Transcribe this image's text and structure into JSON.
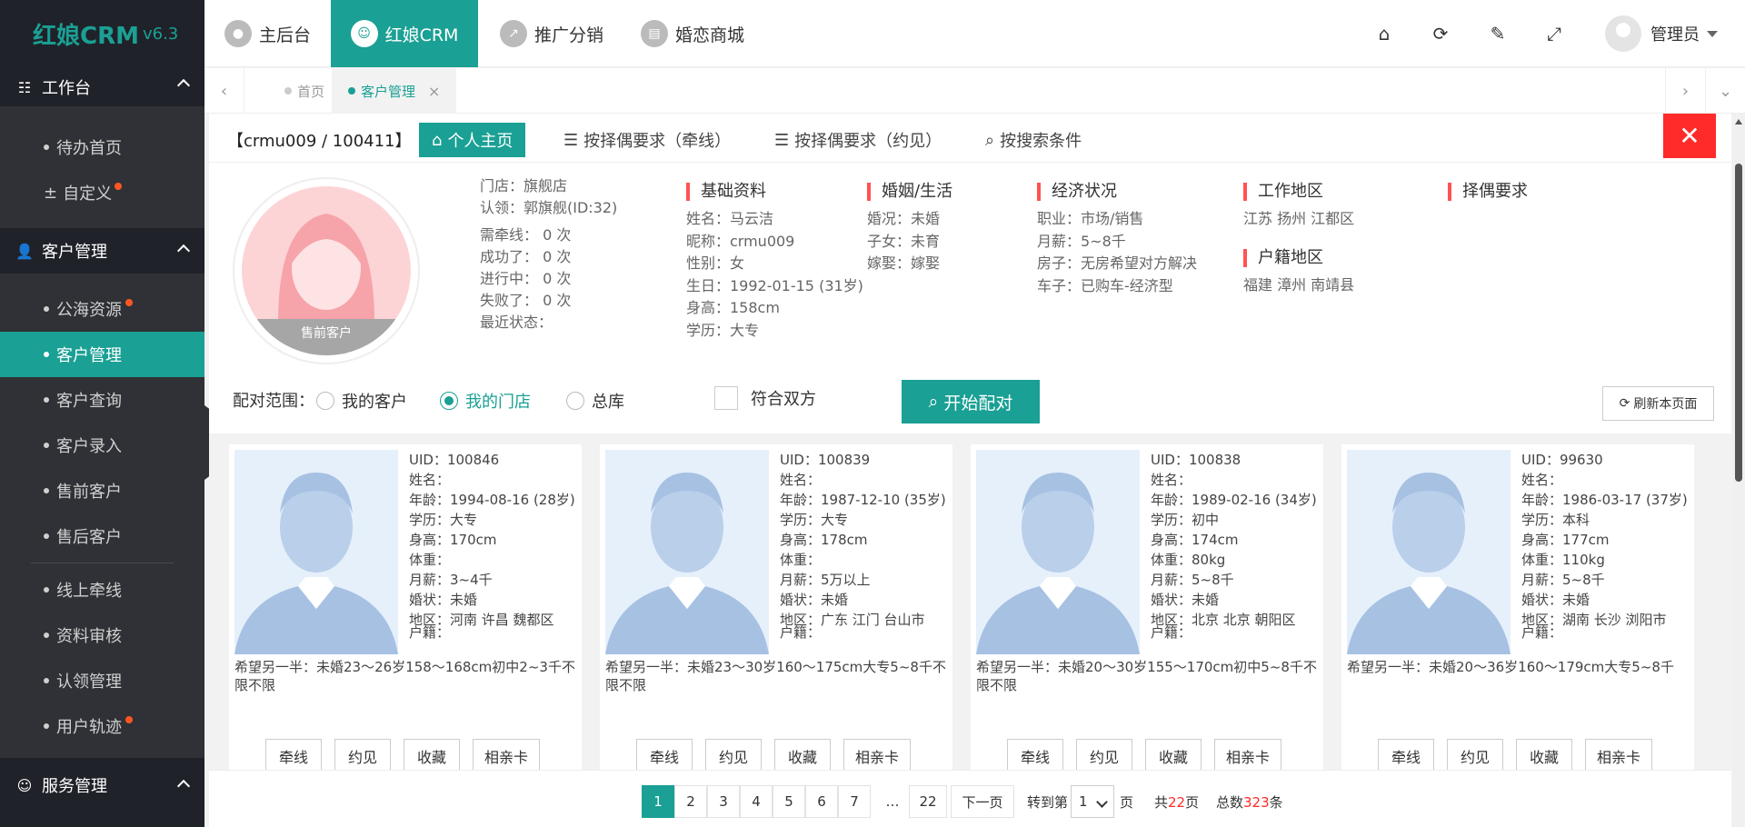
{
  "logo": {
    "name": "红娘CRM",
    "version": "v6.3"
  },
  "sidebar": {
    "groups": [
      {
        "title": "工作台",
        "items": [
          {
            "label": "待办首页"
          },
          {
            "label": "自定义"
          }
        ]
      },
      {
        "title": "客户管理",
        "items": [
          {
            "label": "公海资源"
          },
          {
            "label": "客户管理"
          },
          {
            "label": "客户查询"
          },
          {
            "label": "客户录入"
          },
          {
            "label": "售前客户"
          },
          {
            "label": "售后客户"
          },
          {
            "label": "线上牵线"
          },
          {
            "label": "资料审核"
          },
          {
            "label": "认领管理"
          },
          {
            "label": "用户轨迹"
          }
        ]
      },
      {
        "title": "服务管理",
        "items": []
      }
    ]
  },
  "header": {
    "tabs": [
      {
        "label": "主后台"
      },
      {
        "label": "红娘CRM"
      },
      {
        "label": "推广分销"
      },
      {
        "label": "婚恋商城"
      }
    ],
    "user": "管理员"
  },
  "pagetabs": [
    {
      "label": "首页"
    },
    {
      "label": "客户管理"
    }
  ],
  "toolbar": {
    "customer_id": "【crmu009 / 100411】",
    "buttons": [
      "个人主页",
      "按择偶要求（牵线）",
      "按择偶要求（约见）",
      "按搜索条件"
    ]
  },
  "profile": {
    "photo_label": "售前客户",
    "store": "门店：旗舰店",
    "claim": "认领：郭旗舰(ID:32)",
    "stats": [
      "需牵线：  0 次",
      "成功了：  0 次",
      "进行中：  0 次",
      "失败了：  0 次",
      "最近状态："
    ],
    "sections": {
      "basic": {
        "title": "基础资料",
        "lines": [
          "姓名：马云洁",
          "昵称：crmu009",
          "性别：女",
          "生日：1992-01-15 (31岁)",
          "身高：158cm",
          "学历：大专"
        ]
      },
      "marriage": {
        "title": "婚姻/生活",
        "lines": [
          "婚况：未婚",
          "子女：未育",
          "嫁娶：嫁娶"
        ]
      },
      "economy": {
        "title": "经济状况",
        "lines": [
          "职业：市场/销售",
          "月薪：5~8千",
          "房子：无房希望对方解决",
          "车子：已购车-经济型"
        ]
      },
      "work": {
        "title": "工作地区",
        "lines": [
          "江苏 扬州 江都区"
        ]
      },
      "hukou": {
        "title": "户籍地区",
        "lines": [
          "福建 漳州 南靖县"
        ]
      },
      "mate": {
        "title": "择偶要求",
        "lines": []
      }
    }
  },
  "match": {
    "label": "配对范围：",
    "options": [
      "我的客户",
      "我的门店",
      "总库"
    ],
    "selected": "我的门店",
    "both_label": "符合双方",
    "start_label": "开始配对",
    "refresh_label": "刷新本页面"
  },
  "cards": [
    {
      "uid": "UID：100846",
      "name": "姓名：",
      "age": "年龄：1994-08-16 (28岁)",
      "edu": "学历：大专",
      "height": "身高：170cm",
      "weight": "体重：",
      "salary": "月薪：3~4千",
      "marital": "婚状：未婚",
      "area": "地区：河南 许昌 魏都区",
      "hukou": "户籍：",
      "hope": "希望另一半：未婚23～26岁158～168cm初中2~3千不限不限"
    },
    {
      "uid": "UID：100839",
      "name": "姓名：",
      "age": "年龄：1987-12-10 (35岁)",
      "edu": "学历：大专",
      "height": "身高：178cm",
      "weight": "体重：",
      "salary": "月薪：5万以上",
      "marital": "婚状：未婚",
      "area": "地区：广东 江门 台山市",
      "hukou": "户籍：",
      "hope": "希望另一半：未婚23～30岁160～175cm大专5~8千不限不限"
    },
    {
      "uid": "UID：100838",
      "name": "姓名：",
      "age": "年龄：1989-02-16 (34岁)",
      "edu": "学历：初中",
      "height": "身高：174cm",
      "weight": "体重：80kg",
      "salary": "月薪：5~8千",
      "marital": "婚状：未婚",
      "area": "地区：北京 北京 朝阳区",
      "hukou": "户籍：",
      "hope": "希望另一半：未婚20～30岁155～170cm初中5~8千不限不限"
    },
    {
      "uid": "UID：99630",
      "name": "姓名：",
      "age": "年龄：1986-03-17 (37岁)",
      "edu": "学历：本科",
      "height": "身高：177cm",
      "weight": "体重：110kg",
      "salary": "月薪：5~8千",
      "marital": "婚状：未婚",
      "area": "地区：湖南 长沙 浏阳市",
      "hukou": "户籍：",
      "hope": "希望另一半：未婚20～36岁160～179cm大专5~8千"
    }
  ],
  "card_buttons": [
    "牵线",
    "约见",
    "收藏",
    "相亲卡"
  ],
  "pager": {
    "pages": [
      "1",
      "2",
      "3",
      "4",
      "5",
      "6",
      "7",
      "…",
      "22"
    ],
    "next": "下一页",
    "goto_prefix": "转到第",
    "goto_value": "1",
    "goto_suffix": "页",
    "total_prefix": "共",
    "total_pages": "22",
    "total_pages_suffix": "页",
    "total_count_prefix": "总数",
    "total_count": "323",
    "total_count_suffix": "条"
  },
  "colors": {
    "accent": "#1aa094",
    "sidebar": "#20222a",
    "danger": "#ff2a2a"
  }
}
